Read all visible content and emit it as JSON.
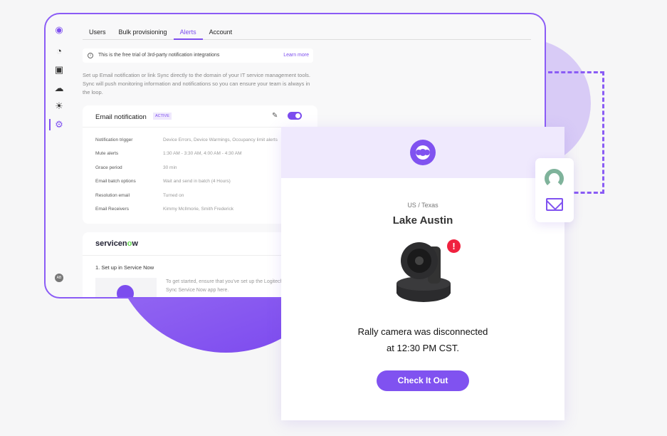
{
  "tabs": [
    {
      "label": "Users"
    },
    {
      "label": "Bulk provisioning"
    },
    {
      "label": "Alerts",
      "active": true
    },
    {
      "label": "Account"
    }
  ],
  "banner": {
    "text": "This is the free trial of 3rd-party notification integrations",
    "link": "Learn more"
  },
  "description": "Set up Email notification or link Sync directly to the domain of your IT service management tools. Sync will push monitoring information and notifications so you can ensure your team is always in the loop.",
  "email": {
    "title": "Email notification",
    "badge": "ACTIVE",
    "enabled": true,
    "rows": [
      {
        "label": "Notification trigger",
        "value": "Device Errors, Device Warmings, Occupancy limit alerts"
      },
      {
        "label": "Mute alerts",
        "value": "1:30 AM - 3:30 AM, 4:00 AM - 4:30 AM"
      },
      {
        "label": "Grace period",
        "value": "30 min"
      },
      {
        "label": "Email batch options",
        "value": "Wait and send in batch (4 Hours)"
      },
      {
        "label": "Resolution email",
        "value": "Turned on"
      },
      {
        "label": "Email Receivers",
        "value": "Kimmy McIlmorie, Smith Frederick"
      }
    ]
  },
  "servicenow": {
    "logo_a": "servicen",
    "logo_b": "o",
    "logo_c": "w",
    "step": "1. Set up in Service Now",
    "text": "To get started, ensure that you've set up the Logitech Sync Service Now app here."
  },
  "avatar": "AB",
  "card": {
    "location": "US / Texas",
    "site": "Lake Austin",
    "alert": "!",
    "message_line1": "Rally camera was disconnected",
    "message_line2": "at 12:30 PM CST.",
    "button": "Check It Out"
  },
  "colors": {
    "accent": "#8052f0",
    "alert": "#f0213f"
  }
}
